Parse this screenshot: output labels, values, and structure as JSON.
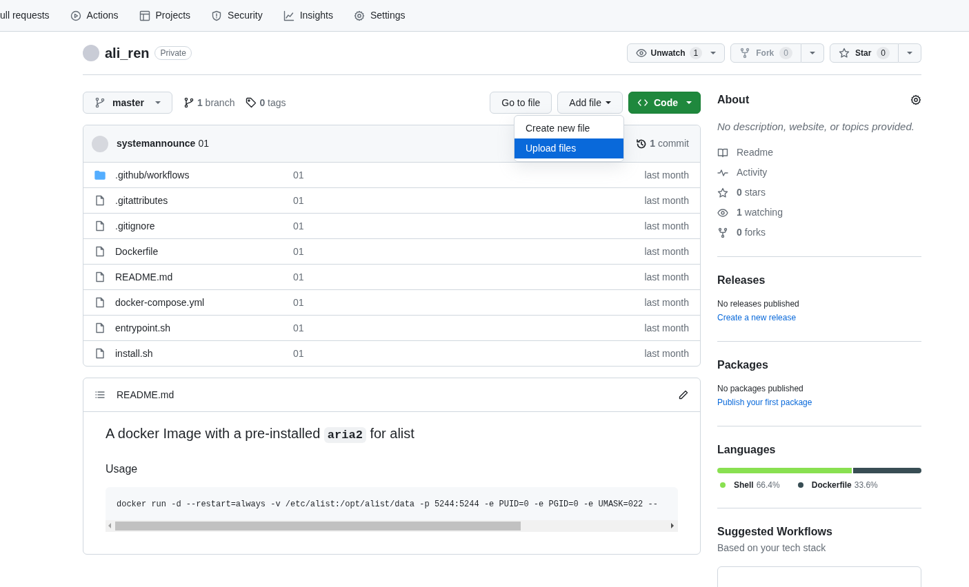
{
  "repo_nav": [
    {
      "label": "ull requests"
    },
    {
      "label": "Actions"
    },
    {
      "label": "Projects"
    },
    {
      "label": "Security"
    },
    {
      "label": "Insights"
    },
    {
      "label": "Settings"
    }
  ],
  "repo": {
    "name": "ali_ren",
    "visibility": "Private"
  },
  "repo_actions": [
    {
      "label": "Unwatch",
      "count": "1",
      "disabled": false,
      "split": false
    },
    {
      "label": "Fork",
      "count": "0",
      "disabled": true,
      "split": true
    },
    {
      "label": "Star",
      "count": "0",
      "disabled": false,
      "split": true
    }
  ],
  "branch_bar": {
    "branch": "master",
    "branches": "**1** branch",
    "tags": "**0** tags",
    "go_to_file": "Go to file",
    "add_file": "Add file",
    "code": "Code"
  },
  "add_file_menu": [
    {
      "label": "Create new file",
      "selected": false
    },
    {
      "label": "Upload files",
      "selected": true
    }
  ],
  "latest_commit": {
    "author": "systemannounce",
    "message": "01",
    "commits": "**1** commit"
  },
  "files": [
    {
      "kind": "folder",
      "name": ".github/workflows",
      "message": "01",
      "time": "last month"
    },
    {
      "kind": "file",
      "name": ".gitattributes",
      "message": "01",
      "time": "last month"
    },
    {
      "kind": "file",
      "name": ".gitignore",
      "message": "01",
      "time": "last month"
    },
    {
      "kind": "file",
      "name": "Dockerfile",
      "message": "01",
      "time": "last month"
    },
    {
      "kind": "file",
      "name": "README.md",
      "message": "01",
      "time": "last month"
    },
    {
      "kind": "file",
      "name": "docker-compose.yml",
      "message": "01",
      "time": "last month"
    },
    {
      "kind": "file",
      "name": "entrypoint.sh",
      "message": "01",
      "time": "last month"
    },
    {
      "kind": "file",
      "name": "install.sh",
      "message": "01",
      "time": "last month"
    }
  ],
  "readme": {
    "title": "README.md",
    "heading": {
      "before": "A docker Image with a pre-installed ",
      "code": "aria2",
      "after": " for alist"
    },
    "subheading": "Usage",
    "code_block": "docker run -d --restart=always -v /etc/alist:/opt/alist/data -p 5244:5244 -e PUID=0 -e PGID=0 -e UMASK=022 --"
  },
  "about": {
    "title": "About",
    "description": "No description, website, or topics provided.",
    "items": [
      {
        "kind": "readme",
        "label": "Readme"
      },
      {
        "kind": "activity",
        "label": "Activity"
      },
      {
        "kind": "stars",
        "label": "**0** stars"
      },
      {
        "kind": "watching",
        "label": "**1** watching"
      },
      {
        "kind": "forks",
        "label": "**0** forks"
      }
    ]
  },
  "releases": {
    "title": "Releases",
    "note": "No releases published",
    "link": "Create a new release"
  },
  "packages": {
    "title": "Packages",
    "note": "No packages published",
    "link": "Publish your first package"
  },
  "languages": {
    "title": "Languages",
    "items": [
      {
        "name": "Shell",
        "percent": "66.4%",
        "level": 0.664,
        "color": "#89e051"
      },
      {
        "name": "Dockerfile",
        "percent": "33.6%",
        "level": 0.336,
        "color": "#384d54"
      }
    ]
  },
  "suggested_workflows": {
    "title": "Suggested Workflows",
    "subtitle": "Based on your tech stack"
  }
}
